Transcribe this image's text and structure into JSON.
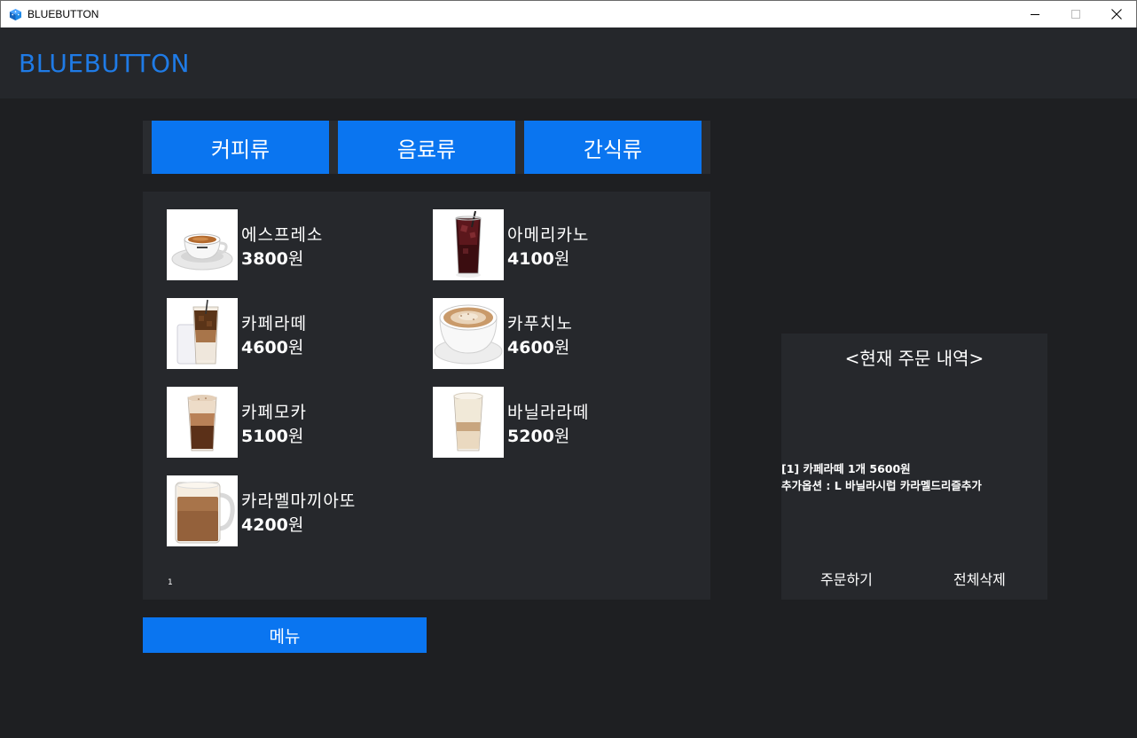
{
  "window": {
    "title": "BLUEBUTTON"
  },
  "header": {
    "brand": "BLUEBUTTON",
    "brand_color": "#1f7be6"
  },
  "accent_color": "#0a75f0",
  "tabs": [
    {
      "label": "커피류"
    },
    {
      "label": "음료류"
    },
    {
      "label": "간식류"
    }
  ],
  "menu": {
    "items": [
      {
        "name": "에스프레소",
        "price": "3800",
        "unit": "원",
        "icon": "espresso-cup"
      },
      {
        "name": "아메리카노",
        "price": "4100",
        "unit": "원",
        "icon": "iced-americano"
      },
      {
        "name": "카페라떼",
        "price": "4600",
        "unit": "원",
        "icon": "iced-latte"
      },
      {
        "name": "카푸치노",
        "price": "4600",
        "unit": "원",
        "icon": "cappuccino-cup"
      },
      {
        "name": "카페모카",
        "price": "5100",
        "unit": "원",
        "icon": "cafe-mocha-glass"
      },
      {
        "name": "바닐라라떼",
        "price": "5200",
        "unit": "원",
        "icon": "vanilla-latte-glass"
      },
      {
        "name": "카라멜마끼아또",
        "price": "4200",
        "unit": "원",
        "icon": "caramel-macchiato-mug"
      }
    ],
    "page": "1",
    "menu_button": "메뉴"
  },
  "order": {
    "title": "<현재 주문 내역>",
    "lines": [
      "[1] 카페라떼 1개 5600원",
      "추가옵션 : L 바닐라시럽 카라멜드리즐추가"
    ],
    "submit": "주문하기",
    "clear": "전체삭제"
  }
}
